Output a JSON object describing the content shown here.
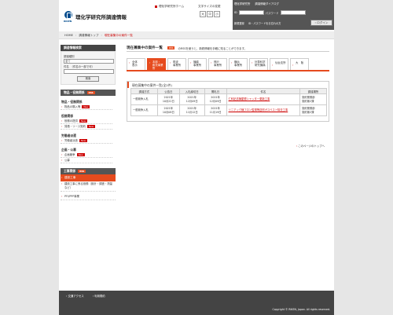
{
  "header": {
    "site_title": "理化学研究所調達情報",
    "logo_sub": "RIKEN",
    "riken_home_link": "理化学研究所ホーム",
    "font_size_label": "文字サイズの変更",
    "font_sizes": [
      "大",
      "中",
      "小"
    ]
  },
  "login": {
    "portal_text_1": "理化学研究所",
    "portal_text_2": "調達情報ダイアログ",
    "id_label": "ID",
    "password_label": "パスワード",
    "register_link": "新規登録",
    "forgot_link": "ID・パスワードをお忘れの方",
    "login_button": "ログイン"
  },
  "breadcrumb": {
    "home": "HOME",
    "parent": "調達情報トップ",
    "current": "現在募集中の案件一覧"
  },
  "sidebar": {
    "search_title": "調達情報検索",
    "category_label": "調達種別",
    "category_value": "全て",
    "keyword_label": "件名",
    "keyword_hint": "（件名の一部で可）",
    "search_button": "検索",
    "goods_header": "物品・役務関係",
    "goods_rss": "RSS",
    "goods_category": "物品・役務関係",
    "goods_items": [
      {
        "label": "物品の購入等",
        "new": "New"
      }
    ],
    "service_category": "役務関係",
    "service_items": [
      {
        "label": "役務の提供",
        "new": "New"
      },
      {
        "label": "賃借・リース契約",
        "new": "New"
      }
    ],
    "labor_category": "労働者派遣",
    "labor_items": [
      {
        "label": "労働者派遣",
        "new": "New"
      }
    ],
    "public_category": "企画・公募",
    "public_items": [
      {
        "label": "企画競争",
        "new": "New"
      },
      {
        "label": "公募",
        "new": ""
      }
    ],
    "construction_header": "工事関係",
    "construction_rss": "RSS",
    "construction_active": "建設工事",
    "construction_item_2": "建設工事に係る役務（設計・調査・測量など）",
    "ppp_item": "PFI/PPP事業"
  },
  "main": {
    "title": "現在募集中の案件一覧",
    "rss_badge": "RSS",
    "rss_desc": "のRSSを使うと、新着情報を手軽に知ることができます。",
    "tabs": [
      {
        "label": "全体\n表示"
      },
      {
        "label": "本部・\n和光事業所"
      },
      {
        "label": "筑波\n事業所"
      },
      {
        "label": "播磨\n事業所"
      },
      {
        "label": "神戸\n事業所"
      },
      {
        "label": "横浜\n事業所"
      },
      {
        "label": "計算科学\n研究機構"
      },
      {
        "label": "仙台支所"
      },
      {
        "label": "大　阪"
      }
    ],
    "result_title": "現在募集中の案件一覧(全2件)",
    "columns": [
      "調達方式",
      "公告日",
      "入札締切日",
      "開札日",
      "件名",
      "調達場所"
    ],
    "rows": [
      {
        "method": "一般競争入札",
        "announce": [
          "2021年",
          "10月22日"
        ],
        "deadline": [
          "2021年",
          "12月09日"
        ],
        "opening": [
          "2021年",
          "12月09日"
        ],
        "subject": "仁科記念棟屋根シャッター更新工事",
        "place": [
          "契約業務部",
          "契約第2課"
        ]
      },
      {
        "method": "一般競争入札",
        "announce": [
          "2021年",
          "10月08日"
        ],
        "deadline": [
          "2021年",
          "11月12日"
        ],
        "opening": [
          "2021年",
          "11月19日"
        ],
        "subject": "リニアック棟フロン監視等送材ガスベスト除去工事",
        "place": [
          "契約業務部",
          "契約第2課"
        ]
      }
    ],
    "back_to_top": "このページのトップへ"
  },
  "footer": {
    "links": [
      "交通アクセス",
      "利用規約"
    ],
    "copyright": "Copyright © RIKEN, Japan. All rights reserved."
  },
  "colors": {
    "accent": "#e64b1e",
    "brand_blue": "#004b8d",
    "dark": "#444444",
    "background": "#e6e6e6"
  }
}
